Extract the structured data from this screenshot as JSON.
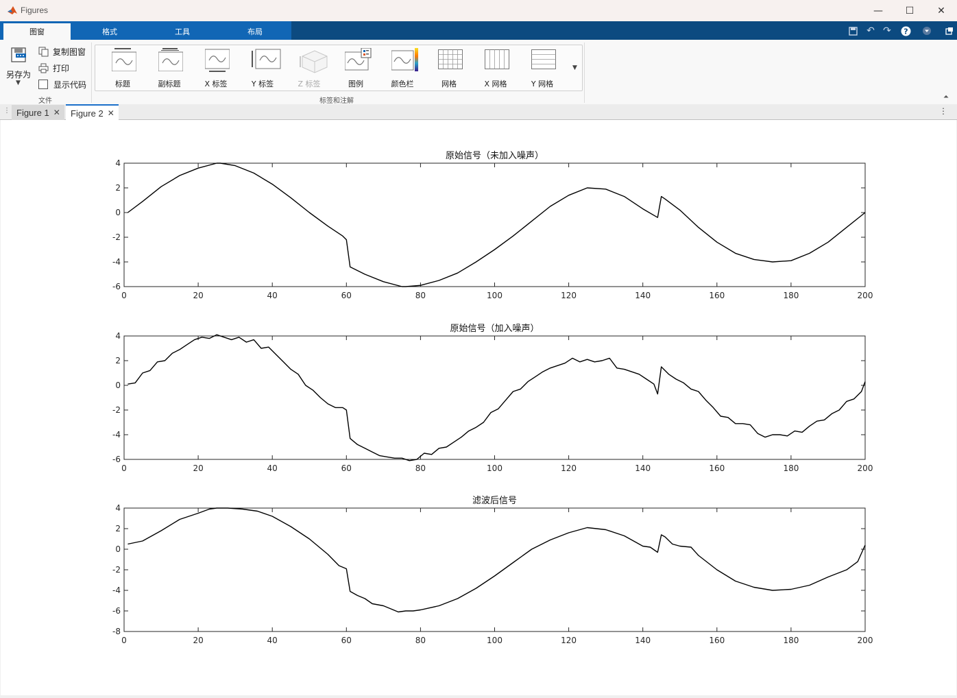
{
  "window": {
    "title": "Figures"
  },
  "ribbon_tabs": [
    "图窗",
    "格式",
    "工具",
    "布局"
  ],
  "file_section": {
    "save_as": "另存为",
    "copy_figure": "复制图窗",
    "print": "打印",
    "show_code": "显示代码",
    "label": "文件"
  },
  "annotation_section": {
    "label": "标签和注解",
    "items": [
      "标题",
      "副标题",
      "X 标签",
      "Y 标签",
      "Z 标签",
      "图例",
      "颜色栏",
      "网格",
      "X 网格",
      "Y 网格"
    ]
  },
  "doc_tabs": [
    "Figure 1",
    "Figure 2"
  ],
  "colors": {
    "ribbon_dark": "#0c4a80",
    "ribbon_tab": "#1166b5",
    "tab_accent": "#1a6fc9",
    "line": "#000000"
  },
  "chart_data": [
    {
      "type": "line",
      "title": "原始信号（未加入噪声）",
      "xlim": [
        0,
        200
      ],
      "ylim": [
        -6,
        4
      ],
      "xticks": [
        0,
        20,
        40,
        60,
        80,
        100,
        120,
        140,
        160,
        180,
        200
      ],
      "yticks": [
        -6,
        -4,
        -2,
        0,
        2,
        4
      ],
      "series": [
        {
          "x": [
            1,
            5,
            10,
            15,
            20,
            25,
            26,
            30,
            35,
            40,
            45,
            50,
            55,
            59,
            60,
            61,
            65,
            70,
            75,
            76,
            80,
            85,
            90,
            95,
            100,
            105,
            110,
            115,
            120,
            125,
            130,
            135,
            140,
            144,
            145,
            146,
            150,
            155,
            160,
            165,
            170,
            175,
            180,
            185,
            190,
            195,
            200
          ],
          "y": [
            0.0,
            0.9,
            2.1,
            3.0,
            3.6,
            4.0,
            4.0,
            3.8,
            3.2,
            2.3,
            1.2,
            0.0,
            -1.1,
            -1.9,
            -2.2,
            -4.4,
            -5.0,
            -5.6,
            -6.0,
            -6.0,
            -5.9,
            -5.5,
            -4.9,
            -4.0,
            -3.0,
            -1.9,
            -0.7,
            0.5,
            1.4,
            2.0,
            1.9,
            1.3,
            0.3,
            -0.4,
            1.3,
            1.1,
            0.2,
            -1.2,
            -2.4,
            -3.3,
            -3.8,
            -4.0,
            -3.9,
            -3.3,
            -2.4,
            -1.2,
            0.0
          ]
        }
      ]
    },
    {
      "type": "line",
      "title": "原始信号（加入噪声）",
      "xlim": [
        0,
        200
      ],
      "ylim": [
        -6,
        4
      ],
      "xticks": [
        0,
        20,
        40,
        60,
        80,
        100,
        120,
        140,
        160,
        180,
        200
      ],
      "yticks": [
        -6,
        -4,
        -2,
        0,
        2,
        4
      ],
      "series": [
        {
          "x": [
            1,
            3,
            5,
            7,
            9,
            11,
            13,
            15,
            17,
            19,
            21,
            23,
            25,
            27,
            29,
            31,
            33,
            35,
            37,
            39,
            41,
            43,
            45,
            47,
            49,
            51,
            53,
            55,
            57,
            59,
            60,
            61,
            63,
            65,
            67,
            69,
            71,
            73,
            75,
            77,
            79,
            81,
            83,
            85,
            87,
            89,
            91,
            93,
            95,
            97,
            99,
            101,
            103,
            105,
            107,
            109,
            111,
            113,
            115,
            117,
            119,
            121,
            123,
            125,
            127,
            129,
            131,
            133,
            135,
            137,
            139,
            141,
            143,
            144,
            145,
            147,
            149,
            151,
            153,
            155,
            157,
            159,
            161,
            163,
            165,
            167,
            169,
            171,
            173,
            175,
            177,
            179,
            181,
            183,
            185,
            187,
            189,
            191,
            193,
            195,
            197,
            199,
            200
          ],
          "y": [
            0.1,
            0.2,
            1.0,
            1.2,
            1.9,
            2.0,
            2.6,
            2.9,
            3.3,
            3.7,
            3.9,
            3.8,
            4.1,
            3.9,
            3.7,
            3.9,
            3.5,
            3.7,
            3.0,
            3.1,
            2.5,
            1.9,
            1.3,
            0.9,
            0.0,
            -0.4,
            -1.0,
            -1.5,
            -1.8,
            -1.8,
            -2.0,
            -4.3,
            -4.8,
            -5.1,
            -5.4,
            -5.7,
            -5.8,
            -5.9,
            -5.9,
            -6.1,
            -6.0,
            -5.5,
            -5.6,
            -5.1,
            -5.0,
            -4.6,
            -4.2,
            -3.7,
            -3.4,
            -3.0,
            -2.2,
            -1.9,
            -1.2,
            -0.5,
            -0.3,
            0.3,
            0.7,
            1.1,
            1.4,
            1.6,
            1.8,
            2.2,
            1.9,
            2.1,
            1.9,
            2.0,
            2.2,
            1.4,
            1.3,
            1.1,
            0.9,
            0.5,
            0.1,
            -0.7,
            1.5,
            0.9,
            0.5,
            0.2,
            -0.3,
            -0.5,
            -1.2,
            -1.8,
            -2.5,
            -2.6,
            -3.1,
            -3.1,
            -3.2,
            -3.9,
            -4.2,
            -4.0,
            -4.0,
            -4.1,
            -3.7,
            -3.8,
            -3.3,
            -2.9,
            -2.8,
            -2.3,
            -2.0,
            -1.3,
            -1.1,
            -0.5,
            0.3
          ]
        }
      ]
    },
    {
      "type": "line",
      "title": "滤波后信号",
      "xlim": [
        0,
        200
      ],
      "ylim": [
        -8,
        4
      ],
      "xticks": [
        0,
        20,
        40,
        60,
        80,
        100,
        120,
        140,
        160,
        180,
        200
      ],
      "yticks": [
        -8,
        -6,
        -4,
        -2,
        0,
        2,
        4
      ],
      "series": [
        {
          "x": [
            1,
            5,
            10,
            15,
            20,
            23,
            25,
            28,
            32,
            36,
            40,
            45,
            50,
            55,
            58,
            60,
            61,
            63,
            65,
            67,
            70,
            72,
            74,
            76,
            78,
            80,
            85,
            90,
            95,
            100,
            105,
            110,
            115,
            120,
            125,
            130,
            135,
            140,
            142,
            144,
            145,
            146,
            148,
            150,
            153,
            155,
            160,
            165,
            170,
            175,
            180,
            185,
            190,
            195,
            198,
            200
          ],
          "y": [
            0.5,
            0.8,
            1.8,
            2.9,
            3.5,
            3.9,
            4.0,
            4.0,
            3.9,
            3.7,
            3.2,
            2.2,
            1.0,
            -0.5,
            -1.6,
            -1.9,
            -4.1,
            -4.5,
            -4.8,
            -5.3,
            -5.5,
            -5.8,
            -6.1,
            -6.0,
            -6.0,
            -5.9,
            -5.5,
            -4.8,
            -3.8,
            -2.6,
            -1.3,
            0.0,
            0.9,
            1.6,
            2.1,
            1.9,
            1.3,
            0.3,
            0.2,
            -0.3,
            1.4,
            1.2,
            0.5,
            0.3,
            0.2,
            -0.6,
            -2.0,
            -3.1,
            -3.7,
            -4.0,
            -3.9,
            -3.5,
            -2.7,
            -2.0,
            -1.2,
            0.4
          ]
        }
      ]
    }
  ]
}
